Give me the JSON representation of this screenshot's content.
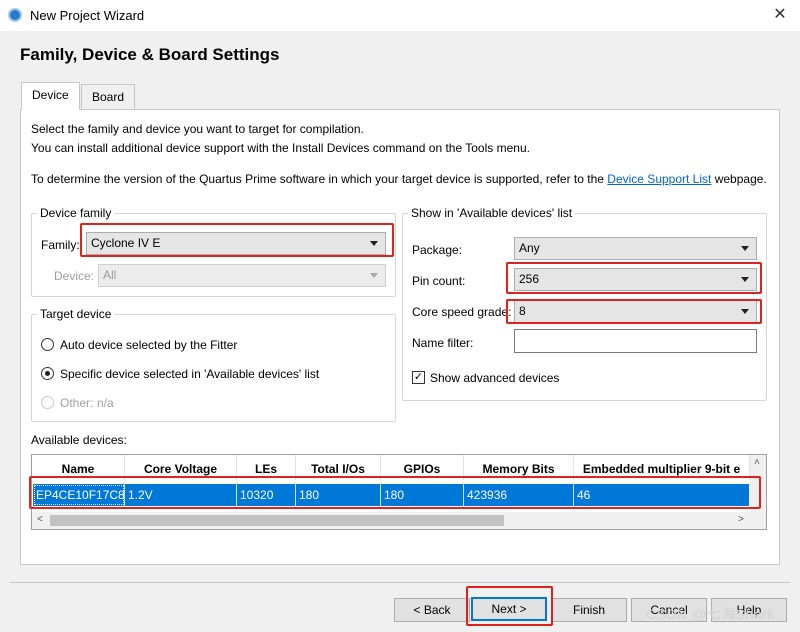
{
  "window": {
    "title": "New Project Wizard"
  },
  "page": {
    "heading": "Family, Device & Board Settings"
  },
  "tabs": [
    {
      "label": "Device"
    },
    {
      "label": "Board"
    }
  ],
  "intro": {
    "line1": "Select the family and device you want to target for compilation.",
    "line2": "You can install additional device support with the Install Devices command on the Tools menu.",
    "line3_prefix": "To determine the version of the Quartus Prime software in which your target device is supported, refer to the",
    "line3_link": "Device Support List",
    "line3_suffix": "webpage."
  },
  "device_family": {
    "title": "Device family",
    "family_label": "Family:",
    "family_value": "Cyclone IV E",
    "device_label": "Device:",
    "device_value": "All"
  },
  "target_device": {
    "title": "Target device",
    "auto_label": "Auto device selected by the Fitter",
    "specific_label": "Specific device selected in 'Available devices' list",
    "other_label": "Other:",
    "other_value": "n/a"
  },
  "show_in": {
    "title": "Show in 'Available devices' list",
    "package_label": "Package:",
    "package_value": "Any",
    "pin_count_label": "Pin count:",
    "pin_count_value": "256",
    "speed_label": "Core speed grade:",
    "speed_value": "8",
    "name_filter_label": "Name filter:",
    "name_filter_value": "",
    "show_advanced_label": "Show advanced devices",
    "show_advanced_checked": true
  },
  "available_devices": {
    "label": "Available devices:",
    "columns": [
      "Name",
      "Core Voltage",
      "LEs",
      "Total I/Os",
      "GPIOs",
      "Memory Bits",
      "Embedded multiplier 9-bit e"
    ],
    "rows": [
      [
        "EP4CE10F17C8",
        "1.2V",
        "10320",
        "180",
        "180",
        "423936",
        "46"
      ]
    ]
  },
  "buttons": {
    "back": "< Back",
    "next": "Next >",
    "finish": "Finish",
    "cancel": "Cancel",
    "help": "Help"
  },
  "watermark": "CSDN @七海Shark",
  "colors": {
    "selection": "#0078d7",
    "highlight_box": "#e0211d",
    "link": "#0066cc"
  }
}
